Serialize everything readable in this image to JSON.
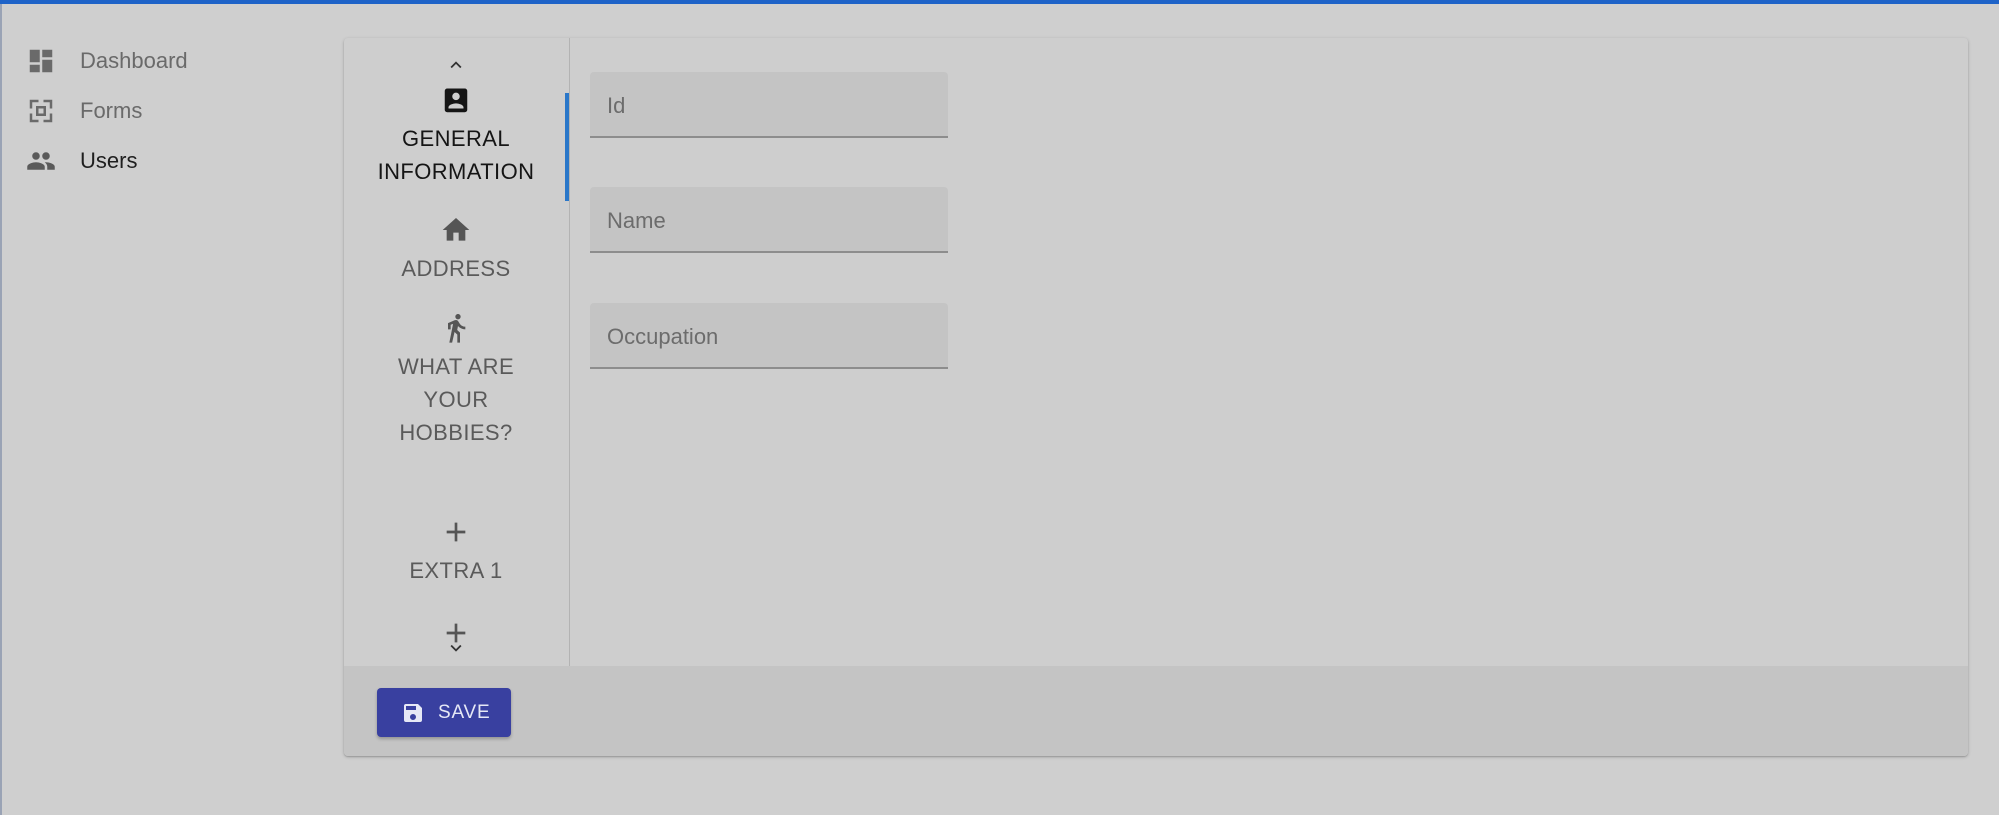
{
  "sidebar": {
    "items": [
      {
        "label": "Dashboard",
        "icon": "dashboard-icon"
      },
      {
        "label": "Forms",
        "icon": "forms-icon"
      },
      {
        "label": "Users",
        "icon": "users-icon",
        "active": true
      }
    ]
  },
  "tabs": {
    "items": [
      {
        "label": "GENERAL INFORMATION",
        "icon": "contact-card-icon",
        "active": true
      },
      {
        "label": "ADDRESS",
        "icon": "home-icon"
      },
      {
        "label": "WHAT ARE YOUR HOBBIES?",
        "icon": "hobby-icon"
      },
      {
        "label": "EXTRA 1",
        "icon": "plus-icon"
      },
      {
        "label": "",
        "icon": "plus-icon"
      }
    ]
  },
  "form": {
    "fields": [
      {
        "placeholder": "Id",
        "value": ""
      },
      {
        "placeholder": "Name",
        "value": ""
      },
      {
        "placeholder": "Occupation",
        "value": ""
      }
    ]
  },
  "footer": {
    "save_label": "SAVE"
  },
  "colors": {
    "accent": "#1e63c8",
    "primary_button": "#3940a0",
    "tab_indicator": "#2a77c9"
  }
}
